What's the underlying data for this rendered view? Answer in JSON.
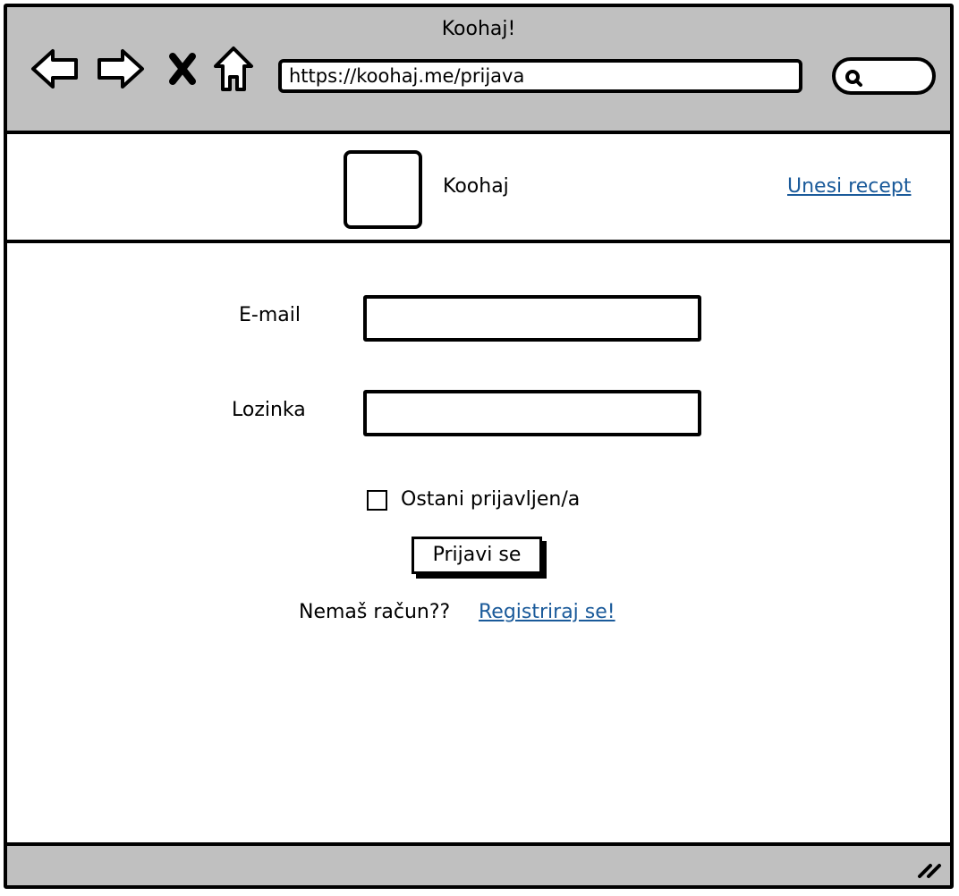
{
  "window": {
    "title": "Koohaj!"
  },
  "toolbar": {
    "back_icon": "arrow-left-icon",
    "forward_icon": "arrow-right-icon",
    "stop_icon": "close-icon",
    "home_icon": "home-icon",
    "url": "https://koohaj.me/prijava",
    "search_icon": "search-icon"
  },
  "header": {
    "brand": "Koohaj",
    "link": "Unesi recept"
  },
  "form": {
    "email_label": "E-mail",
    "email_value": "",
    "password_label": "Lozinka",
    "password_value": "",
    "remember_label": "Ostani prijavljen/a",
    "remember_checked": false,
    "submit_label": "Prijavi se",
    "no_account_text": "Nemaš račun??",
    "register_link": "Registriraj se!"
  },
  "colors": {
    "chrome": "#c0c0c0",
    "link": "#1a5a9a"
  }
}
